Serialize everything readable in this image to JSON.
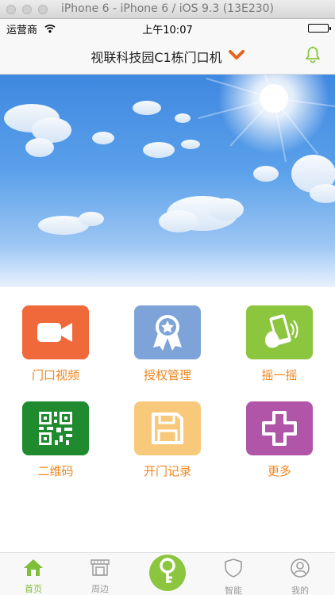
{
  "simulator": {
    "title": "iPhone 6 - iPhone 6 / iOS 9.3 (13E230)"
  },
  "status_bar": {
    "carrier": "运营商",
    "time": "上午10:07"
  },
  "nav": {
    "title": "视联科技园C1栋门口机",
    "accent": "#e8621a",
    "bell_color": "#8cc63f"
  },
  "grid": [
    {
      "label": "门口视频",
      "icon": "video-camera-icon",
      "color": "#f0693a"
    },
    {
      "label": "授权管理",
      "icon": "award-ribbon-icon",
      "color": "#7ea3d8"
    },
    {
      "label": "摇一摇",
      "icon": "shake-phone-icon",
      "color": "#8cc63f"
    },
    {
      "label": "二维码",
      "icon": "qr-code-icon",
      "color": "#1f8a2e"
    },
    {
      "label": "开门记录",
      "icon": "floppy-disk-icon",
      "color": "#f8c97a"
    },
    {
      "label": "更多",
      "icon": "plus-icon",
      "color": "#b055a8"
    }
  ],
  "tabs": [
    {
      "label": "首页",
      "icon": "home-icon"
    },
    {
      "label": "周边",
      "icon": "shop-icon"
    },
    {
      "label": "",
      "icon": "key-icon"
    },
    {
      "label": "智能",
      "icon": "shield-icon"
    },
    {
      "label": "我的",
      "icon": "user-icon"
    }
  ],
  "colors": {
    "label_orange": "#f0861e",
    "tab_active": "#7fbf3a",
    "tab_inactive": "#9a9a9a"
  }
}
